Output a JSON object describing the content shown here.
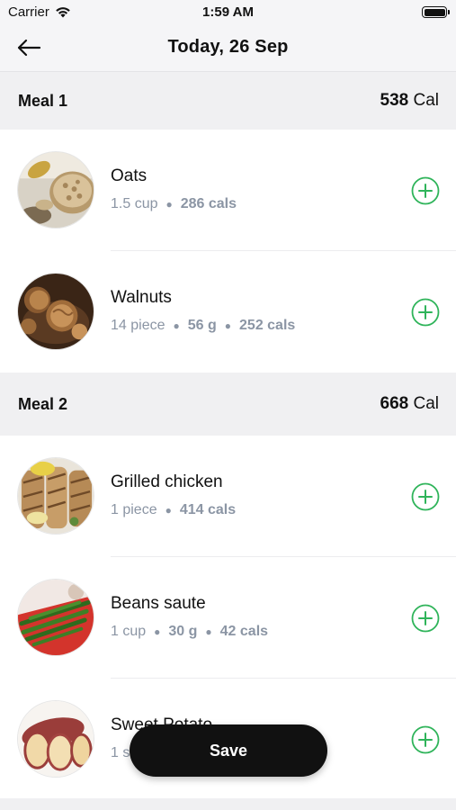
{
  "status_bar": {
    "carrier": "Carrier",
    "time": "1:59 AM",
    "wifi_icon": "wifi-icon",
    "battery_icon": "battery-icon"
  },
  "nav": {
    "title": "Today, 26 Sep",
    "back_icon": "arrow-left-icon"
  },
  "meals": [
    {
      "title": "Meal 1",
      "cal_value": "538",
      "cal_unit": "Cal",
      "items": [
        {
          "name": "Oats",
          "meta": [
            "1.5 cup",
            "286 cals"
          ],
          "image": "oats-photo"
        },
        {
          "name": "Walnuts",
          "meta": [
            "14 piece",
            "56 g",
            "252 cals"
          ],
          "image": "walnuts-photo"
        }
      ]
    },
    {
      "title": "Meal 2",
      "cal_value": "668",
      "cal_unit": "Cal",
      "items": [
        {
          "name": "Grilled chicken",
          "meta": [
            "1 piece",
            "414 cals"
          ],
          "image": "grilled-chicken-photo"
        },
        {
          "name": "Beans saute",
          "meta": [
            "1 cup",
            "30 g",
            "42 cals"
          ],
          "image": "beans-photo"
        },
        {
          "name": "Sweet Potato",
          "meta": [
            "1 s"
          ],
          "image": "sweet-potato-photo"
        }
      ]
    }
  ],
  "save_label": "Save",
  "colors": {
    "accent_green": "#2fb45a",
    "meta_gray": "#8b95a4",
    "header_bg": "#f0f0f2",
    "save_bg": "#111111"
  }
}
